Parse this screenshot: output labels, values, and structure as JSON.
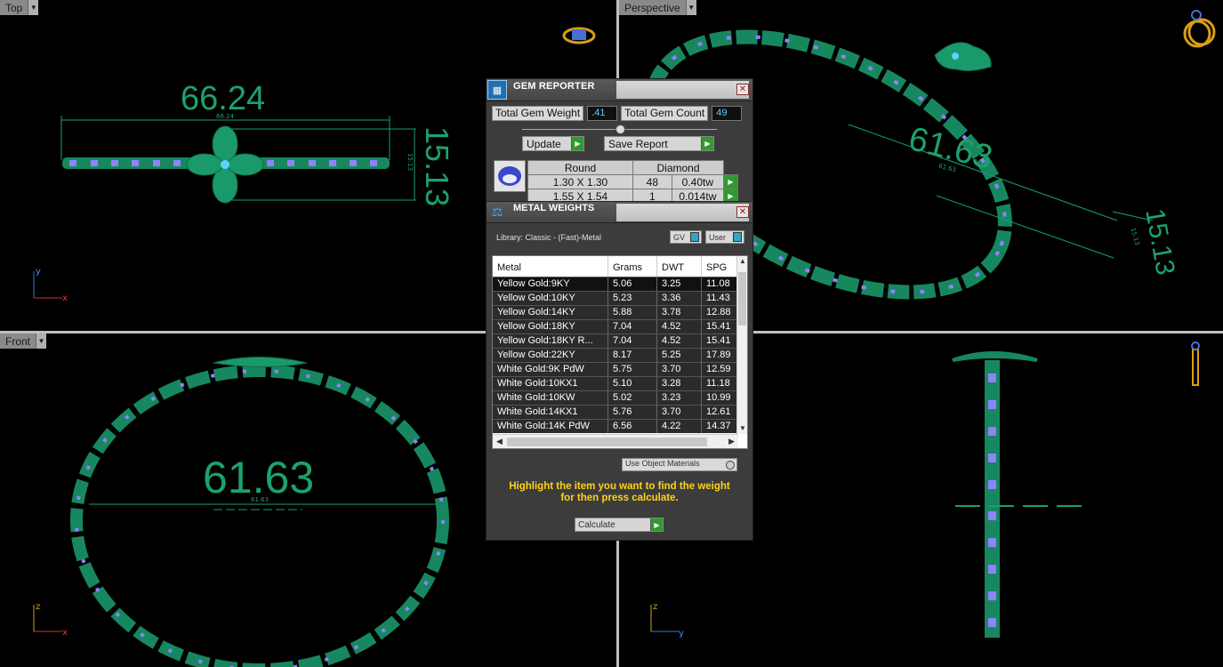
{
  "viewports": {
    "top": {
      "label": "Top",
      "dimension_large": "66.24",
      "dimension_small": "66.24",
      "dimension_side_large": "15.13",
      "dimension_side_small": "15.13",
      "axis_v": "y",
      "axis_h": "x"
    },
    "perspective": {
      "label": "Perspective",
      "dimension_large": "61.63",
      "dimension_small": "61.63",
      "dimension_side_large": "15.13",
      "dimension_side_small": "15.13"
    },
    "front": {
      "label": "Front",
      "dimension_large": "61.63",
      "dimension_small": "61.63",
      "axis_v": "z",
      "axis_h": "x"
    },
    "right": {
      "axis_v": "z",
      "axis_h": "y"
    }
  },
  "gem_reporter": {
    "title": "GEM REPORTER",
    "total_gem_weight_label": "Total Gem Weight",
    "total_gem_weight": ".41",
    "total_gem_count_label": "Total Gem Count",
    "total_gem_count": "49",
    "update_label": "Update",
    "save_report_label": "Save Report",
    "table": {
      "headers": [
        "Round",
        "Diamond"
      ],
      "rows": [
        {
          "size": "1.30 X 1.30",
          "count": "48",
          "weight": "0.40tw"
        },
        {
          "size": "1.55 X 1.54",
          "count": "1",
          "weight": "0.014tw"
        }
      ]
    }
  },
  "metal_weights": {
    "title": "METAL WEIGHTS",
    "library": "Library: Classic - (Fast)-Metal",
    "gv_label": "GV",
    "user_label": "User",
    "columns": [
      "Metal",
      "Grams",
      "DWT",
      "SPG"
    ],
    "rows": [
      {
        "metal": "Yellow Gold:9KY",
        "grams": "5.06",
        "dwt": "3.25",
        "spg": "11.08"
      },
      {
        "metal": "Yellow Gold:10KY",
        "grams": "5.23",
        "dwt": "3.36",
        "spg": "11.43"
      },
      {
        "metal": "Yellow Gold:14KY",
        "grams": "5.88",
        "dwt": "3.78",
        "spg": "12.88"
      },
      {
        "metal": "Yellow Gold:18KY",
        "grams": "7.04",
        "dwt": "4.52",
        "spg": "15.41"
      },
      {
        "metal": "Yellow Gold:18KY R...",
        "grams": "7.04",
        "dwt": "4.52",
        "spg": "15.41"
      },
      {
        "metal": "Yellow Gold:22KY",
        "grams": "8.17",
        "dwt": "5.25",
        "spg": "17.89"
      },
      {
        "metal": "White Gold:9K PdW",
        "grams": "5.75",
        "dwt": "3.70",
        "spg": "12.59"
      },
      {
        "metal": "White Gold:10KX1",
        "grams": "5.10",
        "dwt": "3.28",
        "spg": "11.18"
      },
      {
        "metal": "White Gold:10KW",
        "grams": "5.02",
        "dwt": "3.23",
        "spg": "10.99"
      },
      {
        "metal": "White Gold:14KX1",
        "grams": "5.76",
        "dwt": "3.70",
        "spg": "12.61"
      },
      {
        "metal": "White Gold:14K PdW",
        "grams": "6.56",
        "dwt": "4.22",
        "spg": "14.37"
      }
    ],
    "use_object_materials_label": "Use Object Materials",
    "hint_line1": "Highlight the item you want to find the weight",
    "hint_line2": "for then press calculate.",
    "calculate_label": "Calculate"
  },
  "colors": {
    "model": "#16855e",
    "gem": "#8f82ff",
    "dim_text": "#1aa36e",
    "hint": "#ffd21a"
  }
}
